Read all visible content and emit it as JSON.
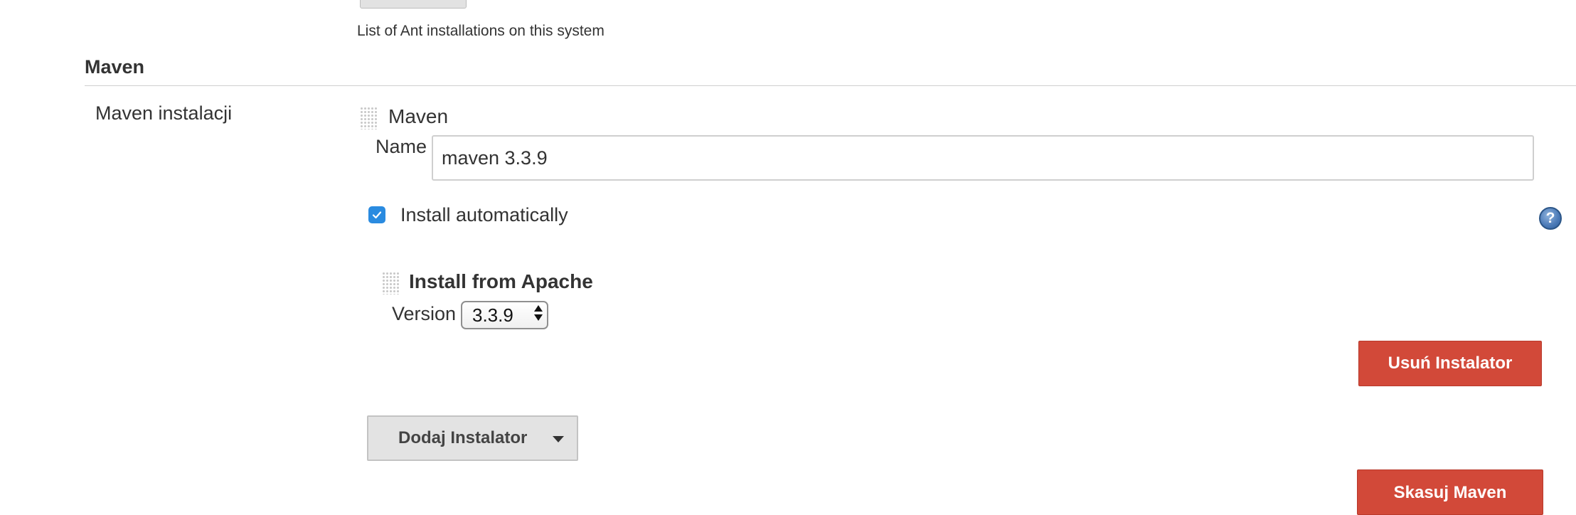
{
  "ant": {
    "help_text": "List of Ant installations on this system"
  },
  "maven_section": {
    "title": "Maven",
    "row_label": "Maven instalacji",
    "item": {
      "title": "Maven",
      "name_label": "Name",
      "name_value": "maven 3.3.9",
      "install_auto_label": "Install automatically",
      "install_auto_checked": true,
      "installer": {
        "title": "Install from Apache",
        "version_label": "Version",
        "version_value": "3.3.9",
        "remove_button": "Usuń Instalator"
      },
      "add_installer_button": "Dodaj Instalator",
      "delete_button": "Skasuj Maven"
    }
  },
  "icons": {
    "help": "help-icon",
    "checkbox_check": "check-icon",
    "drag": "drag-handle-icon",
    "dropdown": "caret-down-icon"
  },
  "colors": {
    "danger": "#d24939",
    "checkbox": "#2a8be0",
    "help": "#4a79b6",
    "text": "#333333"
  }
}
